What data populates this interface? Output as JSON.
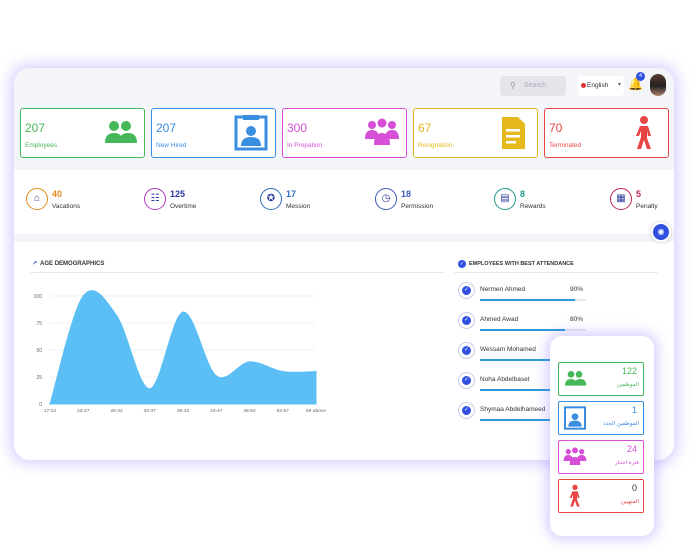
{
  "header": {
    "search_placeholder": "Search",
    "language": "English",
    "notifications_count": "4"
  },
  "stats": [
    {
      "value": "207",
      "label": "Employees",
      "color": "#46b85a",
      "icon": "people-icon"
    },
    {
      "value": "207",
      "label": "New Hired",
      "color": "#3a8ee0",
      "icon": "id-card-icon"
    },
    {
      "value": "300",
      "label": "In Propation",
      "color": "#d64fd6",
      "icon": "group-icon"
    },
    {
      "value": "67",
      "label": "Resignation",
      "color": "#e5b81c",
      "icon": "document-icon"
    },
    {
      "value": "70",
      "label": "Terminated",
      "color": "#e84545",
      "icon": "walking-person-icon"
    }
  ],
  "kpis": [
    {
      "value": "40",
      "label": "Vacations",
      "color": "#e68a1c",
      "icon": "home-icon"
    },
    {
      "value": "125",
      "label": "Overtime",
      "color": "#b03cc0",
      "icon": "calendar-icon"
    },
    {
      "value": "17",
      "label": "Mession",
      "color": "#2a6fc0",
      "icon": "walk-icon"
    },
    {
      "value": "18",
      "label": "Permission",
      "color": "#3b5bb8",
      "icon": "clock-icon"
    },
    {
      "value": "8",
      "label": "Rewards",
      "color": "#1d9a88",
      "icon": "card-icon"
    },
    {
      "value": "5",
      "label": "Penalty",
      "color": "#c0265a",
      "icon": "penalty-icon"
    }
  ],
  "age_chart": {
    "title": "AGE DEMOGRAPHICS",
    "color": "#5bbff5"
  },
  "chart_data": {
    "type": "area",
    "title": "AGE DEMOGRAPHICS",
    "categories": [
      "17-22",
      "23-27",
      "28-32",
      "33-37",
      "38-42",
      "43-47",
      "48-52",
      "53-57",
      "58-above"
    ],
    "values": [
      0,
      100,
      82,
      14,
      85,
      26,
      39,
      30,
      30
    ],
    "yticks": [
      0,
      25,
      50,
      75,
      100
    ],
    "ylim": [
      0,
      100
    ],
    "xlabel": "",
    "ylabel": ""
  },
  "attendance": {
    "title": "EMPLOYEES WITH BEST ATTENDANCE",
    "rows": [
      {
        "name": "Nermen Ahmed",
        "pct": "90%",
        "value": 0.9
      },
      {
        "name": "Ahmed Awad",
        "pct": "80%",
        "value": 0.8
      },
      {
        "name": "Wessam Mohamed",
        "pct": "",
        "value": 0.78
      },
      {
        "name": "Noha Abdelbaset",
        "pct": "",
        "value": 0.72
      },
      {
        "name": "Shymaa Abdelhameed",
        "pct": "",
        "value": 0.68
      }
    ]
  },
  "mobile": {
    "cards": [
      {
        "value": "122",
        "label": "الموظفين",
        "color": "#46b85a",
        "icon": "people-icon"
      },
      {
        "value": "1",
        "label": "الموظفين الجدد",
        "color": "#3a8ee0",
        "icon": "id-card-icon"
      },
      {
        "value": "24",
        "label": "فترة اختبار",
        "color": "#d64fd6",
        "icon": "group-icon"
      },
      {
        "value": "0",
        "label": "المنهيين",
        "color": "#e84545",
        "icon": "walking-person-icon"
      }
    ]
  }
}
